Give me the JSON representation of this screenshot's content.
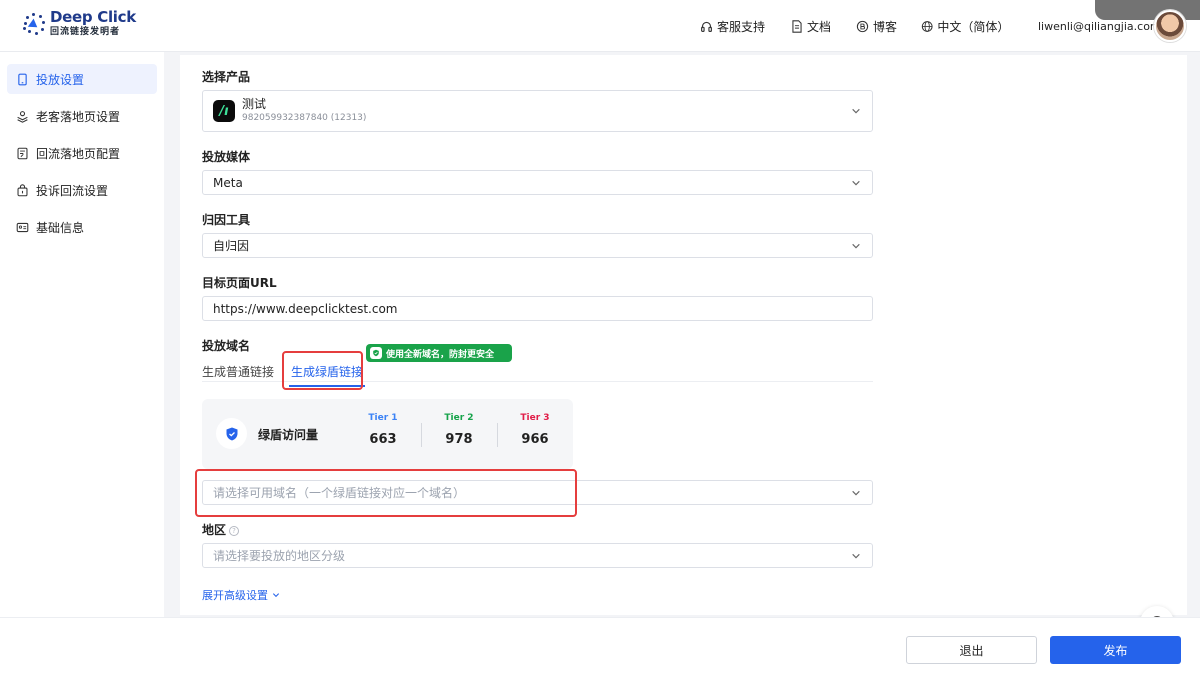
{
  "header": {
    "logo_title": "Deep Click",
    "logo_subtitle": "回流链接发明者",
    "nav": {
      "support": "客服支持",
      "docs": "文档",
      "blog": "博客",
      "language": "中文（简体）",
      "email": "liwenli@qiliangjia.com"
    }
  },
  "sidebar": {
    "items": [
      {
        "label": "投放设置",
        "icon": "phone-icon",
        "active": true
      },
      {
        "label": "老客落地页设置",
        "icon": "user-stack-icon"
      },
      {
        "label": "回流落地页配置",
        "icon": "page-edit-icon"
      },
      {
        "label": "投诉回流设置",
        "icon": "lock-box-icon"
      },
      {
        "label": "基础信息",
        "icon": "id-card-icon"
      }
    ]
  },
  "form": {
    "product": {
      "label": "选择产品",
      "name": "测试",
      "id": "982059932387840 (12313)"
    },
    "media": {
      "label": "投放媒体",
      "value": "Meta"
    },
    "attribution": {
      "label": "归因工具",
      "value": "自归因"
    },
    "target_url": {
      "label": "目标页面URL",
      "value": "https://www.deepclicktest.com"
    },
    "domain": {
      "label": "投放域名",
      "tabs": [
        "生成普通链接",
        "生成绿盾链接"
      ],
      "active_tab": 1,
      "promo": "使用全新域名，防封更安全",
      "stats_label": "绿盾访问量",
      "tiers": [
        {
          "name": "Tier 1",
          "value": "663",
          "color": "#3b82f6"
        },
        {
          "name": "Tier 2",
          "value": "978",
          "color": "#16a34a"
        },
        {
          "name": "Tier 3",
          "value": "966",
          "color": "#e11d48"
        }
      ],
      "select_placeholder": "请选择可用域名（一个绿盾链接对应一个域名）"
    },
    "region": {
      "label": "地区",
      "placeholder": "请选择要投放的地区分级"
    },
    "advanced": "展开高级设置"
  },
  "footer": {
    "exit_label": "退出",
    "publish_label": "发布"
  },
  "colors": {
    "primary": "#2563eb",
    "highlight": "#e53e3e",
    "promo_green": "#1aa34a"
  }
}
